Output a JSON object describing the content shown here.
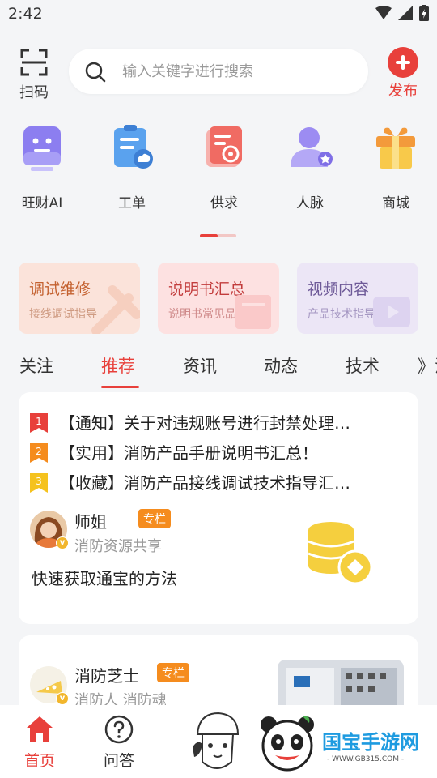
{
  "status_bar": {
    "time": "2:42"
  },
  "top_bar": {
    "scan_label": "扫码",
    "search_placeholder": "输入关键字进行搜索",
    "publish_label": "发布"
  },
  "quick_actions": [
    {
      "label": "旺财AI",
      "icon": "robot-icon"
    },
    {
      "label": "工单",
      "icon": "work-order-icon"
    },
    {
      "label": "供求",
      "icon": "supply-demand-icon"
    },
    {
      "label": "人脉",
      "icon": "contacts-icon"
    },
    {
      "label": "商城",
      "icon": "gift-icon"
    }
  ],
  "category_cards": [
    {
      "title": "调试维修",
      "subtitle": "接线调试指导",
      "bg": "#fbe3da",
      "title_color": "#c4612f",
      "sub_color": "#cf9b82"
    },
    {
      "title": "说明书汇总",
      "subtitle": "说明书常见品牌",
      "bg": "#fde1e1",
      "title_color": "#c23c3c",
      "sub_color": "#cf8a8a"
    },
    {
      "title": "视频内容",
      "subtitle": "产品技术指导",
      "bg": "#ece6f6",
      "title_color": "#6e5a98",
      "sub_color": "#a597c2"
    }
  ],
  "tabs": [
    "关注",
    "推荐",
    "资讯",
    "动态",
    "技术",
    "》法"
  ],
  "active_tab": "推荐",
  "notices": [
    {
      "rank": "1",
      "text": "【通知】关于对违规账号进行封禁处理…",
      "color": "#e8403b"
    },
    {
      "rank": "2",
      "text": "【实用】消防产品手册说明书汇总！",
      "color": "#f58c1e"
    },
    {
      "rank": "3",
      "text": "【收藏】消防产品接线调试技术指导汇…",
      "color": "#f5c21e"
    }
  ],
  "post1": {
    "author": "师姐",
    "badge": "专栏",
    "subtitle": "消防资源共享",
    "title": "快速获取通宝的方法"
  },
  "post2": {
    "author": "消防芝士",
    "badge": "专栏",
    "subtitle": "消防人 消防魂"
  },
  "bottom_nav": [
    {
      "label": "首页",
      "active": true
    },
    {
      "label": "问答",
      "active": false
    }
  ],
  "watermark": {
    "text": "国宝手游网",
    "url": "- WWW.GB315.COM -"
  },
  "colors": {
    "accent": "#e8403b",
    "badge": "#f58c1e",
    "coin": "#f5cf3e"
  }
}
